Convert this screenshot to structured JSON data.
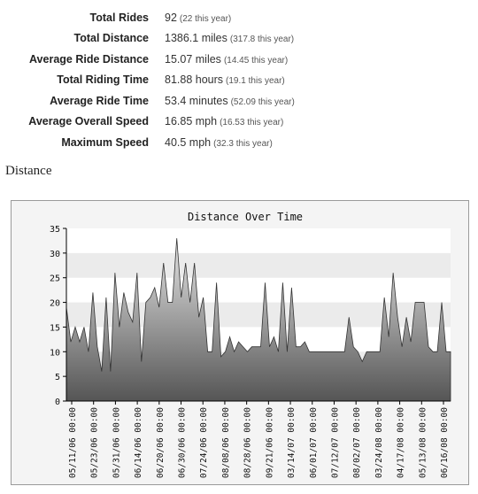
{
  "stats": [
    {
      "label": "Total Rides",
      "value": "92",
      "sub": "(22 this year)"
    },
    {
      "label": "Total Distance",
      "value": "1386.1 miles",
      "sub": "(317.8 this year)"
    },
    {
      "label": "Average Ride Distance",
      "value": "15.07 miles",
      "sub": "(14.45 this year)"
    },
    {
      "label": "Total Riding Time",
      "value": "81.88 hours",
      "sub": "(19.1 this year)"
    },
    {
      "label": "Average Ride Time",
      "value": "53.4 minutes",
      "sub": "(52.09 this year)"
    },
    {
      "label": "Average Overall Speed",
      "value": "16.85 mph",
      "sub": "(16.53 this year)"
    },
    {
      "label": "Maximum Speed",
      "value": "40.5 mph",
      "sub": "(32.3 this year)"
    }
  ],
  "section_heading": "Distance",
  "colors": {
    "fill_top": "#e6e6e6",
    "fill_bottom": "#555555",
    "band": "#ebebeb",
    "axis": "#000000"
  },
  "chart_data": {
    "type": "area",
    "title": "Distance Over Time",
    "xlabel": "",
    "ylabel": "",
    "ylim": [
      0,
      35
    ],
    "yticks": [
      0,
      5,
      10,
      15,
      20,
      25,
      30,
      35
    ],
    "grid": "alternating horizontal bands",
    "x_tick_labels": [
      "05/11/06 00:00",
      "05/23/06 00:00",
      "05/31/06 00:00",
      "06/14/06 00:00",
      "06/20/06 00:00",
      "06/30/06 00:00",
      "07/24/06 00:00",
      "08/08/06 00:00",
      "08/28/06 00:00",
      "09/21/06 00:00",
      "03/14/07 00:00",
      "06/01/07 00:00",
      "07/12/07 00:00",
      "08/02/07 00:00",
      "03/24/08 00:00",
      "04/17/08 00:00",
      "05/13/08 00:00",
      "06/16/08 00:00"
    ],
    "series": [
      {
        "values": [
          19,
          12,
          15,
          12,
          15,
          10,
          22,
          11,
          6,
          21,
          6,
          26,
          15,
          22,
          18,
          16,
          26,
          8,
          20,
          21,
          23,
          19,
          28,
          20,
          20,
          33,
          21,
          28,
          20,
          28,
          17,
          21,
          10,
          10,
          24,
          9,
          10,
          13,
          10,
          12,
          11,
          10,
          11,
          11,
          11,
          24,
          11,
          13,
          10,
          24,
          10,
          23,
          11,
          11,
          12,
          10,
          10,
          10,
          10,
          10,
          10,
          10,
          10,
          10,
          17,
          11,
          10,
          8,
          10,
          10,
          10,
          10,
          21,
          13,
          26,
          17,
          11,
          17,
          12,
          20,
          20,
          20,
          11,
          10,
          10,
          20,
          10,
          10
        ]
      }
    ]
  }
}
